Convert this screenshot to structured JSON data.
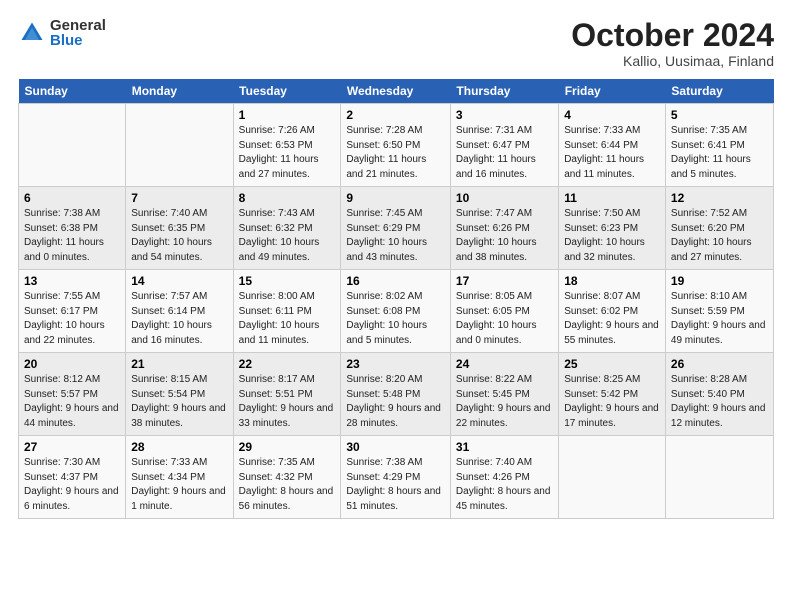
{
  "logo": {
    "general": "General",
    "blue": "Blue"
  },
  "header": {
    "month": "October 2024",
    "location": "Kallio, Uusimaa, Finland"
  },
  "days_of_week": [
    "Sunday",
    "Monday",
    "Tuesday",
    "Wednesday",
    "Thursday",
    "Friday",
    "Saturday"
  ],
  "weeks": [
    [
      {
        "day": "",
        "info": ""
      },
      {
        "day": "",
        "info": ""
      },
      {
        "day": "1",
        "info": "Sunrise: 7:26 AM\nSunset: 6:53 PM\nDaylight: 11 hours and 27 minutes."
      },
      {
        "day": "2",
        "info": "Sunrise: 7:28 AM\nSunset: 6:50 PM\nDaylight: 11 hours and 21 minutes."
      },
      {
        "day": "3",
        "info": "Sunrise: 7:31 AM\nSunset: 6:47 PM\nDaylight: 11 hours and 16 minutes."
      },
      {
        "day": "4",
        "info": "Sunrise: 7:33 AM\nSunset: 6:44 PM\nDaylight: 11 hours and 11 minutes."
      },
      {
        "day": "5",
        "info": "Sunrise: 7:35 AM\nSunset: 6:41 PM\nDaylight: 11 hours and 5 minutes."
      }
    ],
    [
      {
        "day": "6",
        "info": "Sunrise: 7:38 AM\nSunset: 6:38 PM\nDaylight: 11 hours and 0 minutes."
      },
      {
        "day": "7",
        "info": "Sunrise: 7:40 AM\nSunset: 6:35 PM\nDaylight: 10 hours and 54 minutes."
      },
      {
        "day": "8",
        "info": "Sunrise: 7:43 AM\nSunset: 6:32 PM\nDaylight: 10 hours and 49 minutes."
      },
      {
        "day": "9",
        "info": "Sunrise: 7:45 AM\nSunset: 6:29 PM\nDaylight: 10 hours and 43 minutes."
      },
      {
        "day": "10",
        "info": "Sunrise: 7:47 AM\nSunset: 6:26 PM\nDaylight: 10 hours and 38 minutes."
      },
      {
        "day": "11",
        "info": "Sunrise: 7:50 AM\nSunset: 6:23 PM\nDaylight: 10 hours and 32 minutes."
      },
      {
        "day": "12",
        "info": "Sunrise: 7:52 AM\nSunset: 6:20 PM\nDaylight: 10 hours and 27 minutes."
      }
    ],
    [
      {
        "day": "13",
        "info": "Sunrise: 7:55 AM\nSunset: 6:17 PM\nDaylight: 10 hours and 22 minutes."
      },
      {
        "day": "14",
        "info": "Sunrise: 7:57 AM\nSunset: 6:14 PM\nDaylight: 10 hours and 16 minutes."
      },
      {
        "day": "15",
        "info": "Sunrise: 8:00 AM\nSunset: 6:11 PM\nDaylight: 10 hours and 11 minutes."
      },
      {
        "day": "16",
        "info": "Sunrise: 8:02 AM\nSunset: 6:08 PM\nDaylight: 10 hours and 5 minutes."
      },
      {
        "day": "17",
        "info": "Sunrise: 8:05 AM\nSunset: 6:05 PM\nDaylight: 10 hours and 0 minutes."
      },
      {
        "day": "18",
        "info": "Sunrise: 8:07 AM\nSunset: 6:02 PM\nDaylight: 9 hours and 55 minutes."
      },
      {
        "day": "19",
        "info": "Sunrise: 8:10 AM\nSunset: 5:59 PM\nDaylight: 9 hours and 49 minutes."
      }
    ],
    [
      {
        "day": "20",
        "info": "Sunrise: 8:12 AM\nSunset: 5:57 PM\nDaylight: 9 hours and 44 minutes."
      },
      {
        "day": "21",
        "info": "Sunrise: 8:15 AM\nSunset: 5:54 PM\nDaylight: 9 hours and 38 minutes."
      },
      {
        "day": "22",
        "info": "Sunrise: 8:17 AM\nSunset: 5:51 PM\nDaylight: 9 hours and 33 minutes."
      },
      {
        "day": "23",
        "info": "Sunrise: 8:20 AM\nSunset: 5:48 PM\nDaylight: 9 hours and 28 minutes."
      },
      {
        "day": "24",
        "info": "Sunrise: 8:22 AM\nSunset: 5:45 PM\nDaylight: 9 hours and 22 minutes."
      },
      {
        "day": "25",
        "info": "Sunrise: 8:25 AM\nSunset: 5:42 PM\nDaylight: 9 hours and 17 minutes."
      },
      {
        "day": "26",
        "info": "Sunrise: 8:28 AM\nSunset: 5:40 PM\nDaylight: 9 hours and 12 minutes."
      }
    ],
    [
      {
        "day": "27",
        "info": "Sunrise: 7:30 AM\nSunset: 4:37 PM\nDaylight: 9 hours and 6 minutes."
      },
      {
        "day": "28",
        "info": "Sunrise: 7:33 AM\nSunset: 4:34 PM\nDaylight: 9 hours and 1 minute."
      },
      {
        "day": "29",
        "info": "Sunrise: 7:35 AM\nSunset: 4:32 PM\nDaylight: 8 hours and 56 minutes."
      },
      {
        "day": "30",
        "info": "Sunrise: 7:38 AM\nSunset: 4:29 PM\nDaylight: 8 hours and 51 minutes."
      },
      {
        "day": "31",
        "info": "Sunrise: 7:40 AM\nSunset: 4:26 PM\nDaylight: 8 hours and 45 minutes."
      },
      {
        "day": "",
        "info": ""
      },
      {
        "day": "",
        "info": ""
      }
    ]
  ]
}
